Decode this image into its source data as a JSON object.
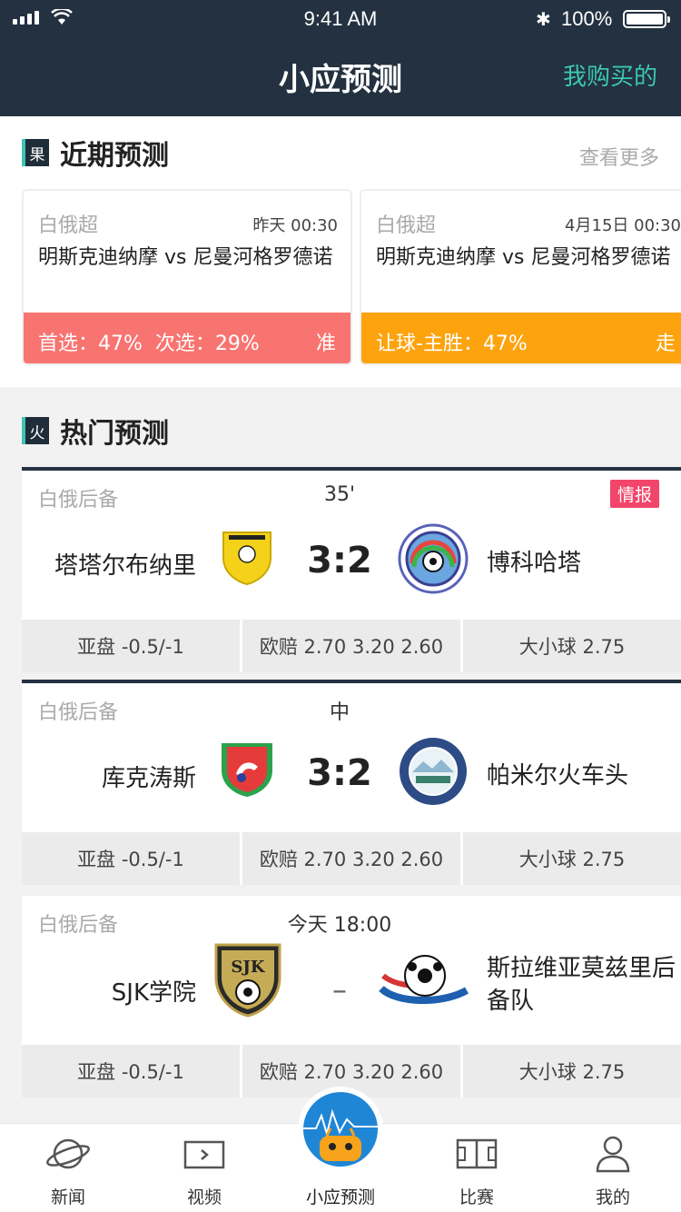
{
  "status_bar": {
    "time": "9:41 AM",
    "battery": "100%"
  },
  "nav": {
    "title": "小应预测",
    "right_link": "我购买的"
  },
  "recent": {
    "icon_char": "果",
    "title": "近期预测",
    "more": "查看更多",
    "cards": [
      {
        "league": "白俄超",
        "time": "昨天 00:30",
        "match": "明斯克迪纳摩 vs 尼曼河格罗德诺",
        "pick": "首选：47%  次选：29%",
        "result": "准",
        "color": "#f87470"
      },
      {
        "league": "白俄超",
        "time": "4月15日 00:30",
        "match": "明斯克迪纳摩 vs 尼曼河格罗德诺",
        "pick": "让球-主胜：47%",
        "result": "走",
        "color": "#fda30e"
      }
    ]
  },
  "hot": {
    "icon_char": "火",
    "title": "热门预测",
    "matches": [
      {
        "league": "白俄后备",
        "status": "35'",
        "tag": "情报",
        "home": "塔塔尔布纳里",
        "score": "3:2",
        "away": "博科哈塔",
        "odds": [
          "亚盘 -0.5/-1",
          "欧赔 2.70 3.20 2.60",
          "大小球 2.75"
        ]
      },
      {
        "league": "白俄后备",
        "status": "中",
        "tag": "",
        "home": "库克涛斯",
        "score": "3:2",
        "away": "帕米尔火车头",
        "odds": [
          "亚盘 -0.5/-1",
          "欧赔 2.70 3.20 2.60",
          "大小球 2.75"
        ]
      },
      {
        "league": "白俄后备",
        "status": "今天 18:00",
        "tag": "",
        "home": "SJK学院",
        "score": "–",
        "away": "斯拉维亚莫兹里后备队",
        "odds": [
          "亚盘 -0.5/-1",
          "欧赔 2.70 3.20 2.60",
          "大小球 2.75"
        ]
      }
    ]
  },
  "logos": {
    "sjk_text": "SJK"
  },
  "tabbar": [
    {
      "label": "新闻",
      "icon": "planet-icon"
    },
    {
      "label": "视频",
      "icon": "video-icon"
    },
    {
      "label": "小应预测",
      "icon": "mascot-icon"
    },
    {
      "label": "比赛",
      "icon": "pitch-icon"
    },
    {
      "label": "我的",
      "icon": "user-icon"
    }
  ],
  "colors": {
    "header": "#233140",
    "accent": "#3cc6b4",
    "tag": "#f2456a"
  }
}
